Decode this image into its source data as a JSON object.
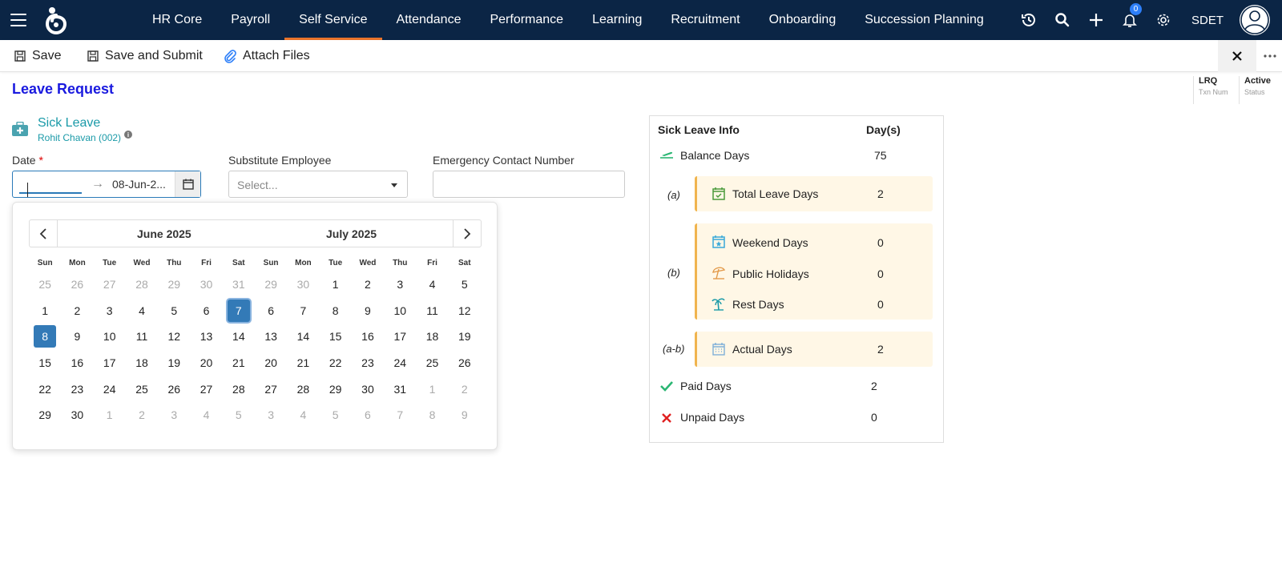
{
  "nav": {
    "items": [
      "HR Core",
      "Payroll",
      "Self Service",
      "Attendance",
      "Performance",
      "Learning",
      "Recruitment",
      "Onboarding",
      "Succession Planning"
    ],
    "active_index": 2,
    "notification_count": "0",
    "user": "SDET"
  },
  "toolbar": {
    "save_label": "Save",
    "save_submit_label": "Save and Submit",
    "attach_label": "Attach Files"
  },
  "page": {
    "title": "Leave Request",
    "txn_num_value": "LRQ",
    "txn_num_label": "Txn Num",
    "status_value": "Active",
    "status_label": "Status"
  },
  "leave": {
    "type": "Sick Leave",
    "employee": "Rohit Chavan (002)"
  },
  "form": {
    "date_label": "Date",
    "date_required": "*",
    "date_start": "",
    "date_end": "08-Jun-2...",
    "substitute_label": "Substitute Employee",
    "substitute_placeholder": "Select...",
    "emergency_label": "Emergency Contact Number",
    "emergency_value": ""
  },
  "calendar": {
    "month1": "June 2025",
    "month2": "July 2025",
    "dow": [
      "Sun",
      "Mon",
      "Tue",
      "Wed",
      "Thu",
      "Fri",
      "Sat",
      "Sun",
      "Mon",
      "Tue",
      "Wed",
      "Thu",
      "Fri",
      "Sat"
    ],
    "rows": [
      [
        "25",
        "26",
        "27",
        "28",
        "29",
        "30",
        "31",
        "29",
        "30",
        "1",
        "2",
        "3",
        "4",
        "5"
      ],
      [
        "1",
        "2",
        "3",
        "4",
        "5",
        "6",
        "7",
        "6",
        "7",
        "8",
        "9",
        "10",
        "11",
        "12"
      ],
      [
        "8",
        "9",
        "10",
        "11",
        "12",
        "13",
        "14",
        "13",
        "14",
        "15",
        "16",
        "17",
        "18",
        "19"
      ],
      [
        "15",
        "16",
        "17",
        "18",
        "19",
        "20",
        "21",
        "20",
        "21",
        "22",
        "23",
        "24",
        "25",
        "26"
      ],
      [
        "22",
        "23",
        "24",
        "25",
        "26",
        "27",
        "28",
        "27",
        "28",
        "29",
        "30",
        "31",
        "1",
        "2"
      ],
      [
        "29",
        "30",
        "1",
        "2",
        "3",
        "4",
        "5",
        "3",
        "4",
        "5",
        "6",
        "7",
        "8",
        "9"
      ]
    ],
    "muted": [
      [
        1,
        1,
        1,
        1,
        1,
        1,
        1,
        1,
        1,
        0,
        0,
        0,
        0,
        0
      ],
      [
        0,
        0,
        0,
        0,
        0,
        0,
        0,
        0,
        0,
        0,
        0,
        0,
        0,
        0
      ],
      [
        0,
        0,
        0,
        0,
        0,
        0,
        0,
        0,
        0,
        0,
        0,
        0,
        0,
        0
      ],
      [
        0,
        0,
        0,
        0,
        0,
        0,
        0,
        0,
        0,
        0,
        0,
        0,
        0,
        0
      ],
      [
        0,
        0,
        0,
        0,
        0,
        0,
        0,
        0,
        0,
        0,
        0,
        0,
        1,
        1
      ],
      [
        0,
        0,
        1,
        1,
        1,
        1,
        1,
        1,
        1,
        1,
        1,
        1,
        1,
        1
      ]
    ],
    "selected": [
      [
        1,
        6
      ],
      [
        2,
        0
      ]
    ]
  },
  "info": {
    "header_left": "Sick Leave Info",
    "header_right": "Day(s)",
    "balance_label": "Balance Days",
    "balance_value": "75",
    "a": "(a)",
    "total_label": "Total Leave Days",
    "total_value": "2",
    "b": "(b)",
    "weekend_label": "Weekend Days",
    "weekend_value": "0",
    "holiday_label": "Public Holidays",
    "holiday_value": "0",
    "rest_label": "Rest Days",
    "rest_value": "0",
    "ab": "(a-b)",
    "actual_label": "Actual Days",
    "actual_value": "2",
    "paid_label": "Paid Days",
    "paid_value": "2",
    "unpaid_label": "Unpaid Days",
    "unpaid_value": "0"
  },
  "colors": {
    "nav_bg": "#0b2545",
    "nav_active_underline": "#e9742b",
    "title_blue": "#1a1adf",
    "teal": "#1a9aa8",
    "calendar_selected": "#337ab7",
    "card_bg": "#fff7e6",
    "card_border": "#f0b44e",
    "paid_check": "#2bb673",
    "unpaid_x": "#e02020"
  }
}
